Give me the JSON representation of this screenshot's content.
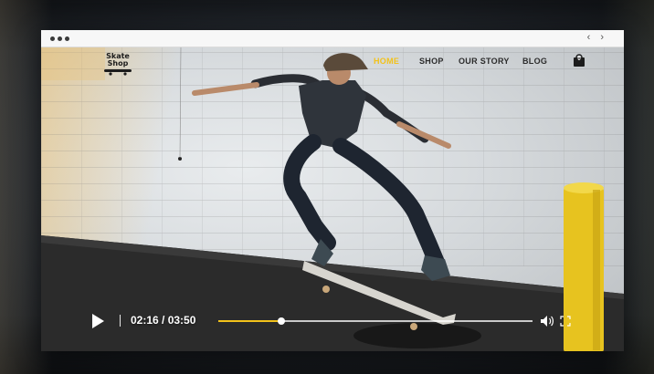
{
  "window": {
    "arrows": "‹ ›"
  },
  "site": {
    "logo_line1": "Skate",
    "logo_line2": "Shop",
    "nav": [
      {
        "label": "HOME",
        "active": true
      },
      {
        "label": "SHOP",
        "active": false
      },
      {
        "label": "OUR STORY",
        "active": false
      },
      {
        "label": "BLOG",
        "active": false
      }
    ],
    "cart_count": "0",
    "accent_color": "#f2c21b"
  },
  "player": {
    "time": "02:16 / 03:50",
    "progress": 0.2,
    "icons": [
      "play-icon",
      "volume-icon",
      "fullscreen-icon"
    ]
  }
}
